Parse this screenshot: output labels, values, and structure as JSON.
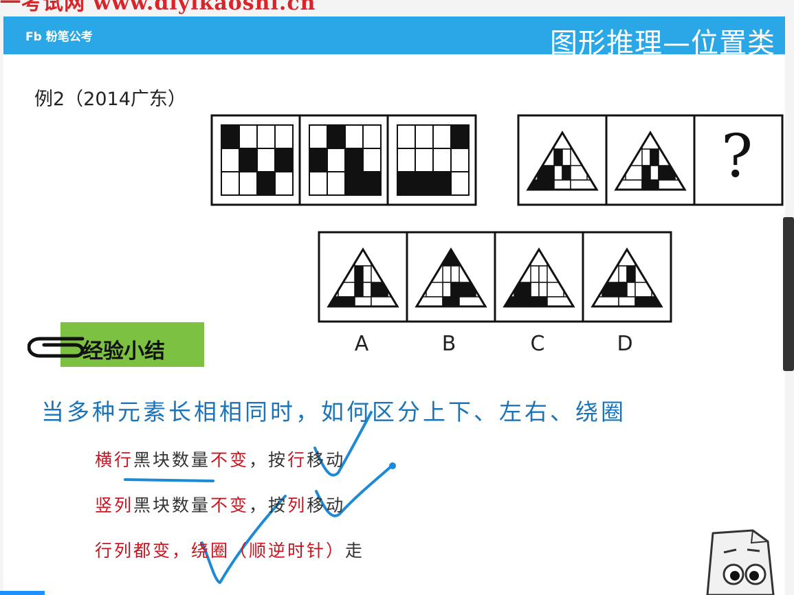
{
  "watermark": "一考试网 www.diyikaoshi.cn",
  "header": {
    "logo": "Fb 粉笔公考",
    "title": "图形推理—位置类"
  },
  "example_label": "例2（2014广东）",
  "puzzle": {
    "question_mark": "?",
    "options": [
      "A",
      "B",
      "C",
      "D"
    ]
  },
  "summary": {
    "label": "经验小结",
    "question": "当多种元素长相相同时，如何区分上下、左右、绕圈",
    "rules": [
      {
        "red": "横行",
        "black1": "黑块数量",
        "red2": "不变",
        "black2": "，按",
        "red3": "行",
        "black3": "移动"
      },
      {
        "red": "竖列",
        "black1": "黑块数量",
        "red2": "不变",
        "black2": "，按",
        "red3": "列",
        "black3": "移动"
      },
      {
        "red": "行列都变，绕圈（顺逆时针）",
        "black1": "走"
      }
    ]
  },
  "colors": {
    "header": "#2aa7e6",
    "summary_bg": "#7cc142",
    "question_text": "#1c74b8",
    "rule_red": "#c8141e",
    "annotation": "#1e8ad6"
  }
}
